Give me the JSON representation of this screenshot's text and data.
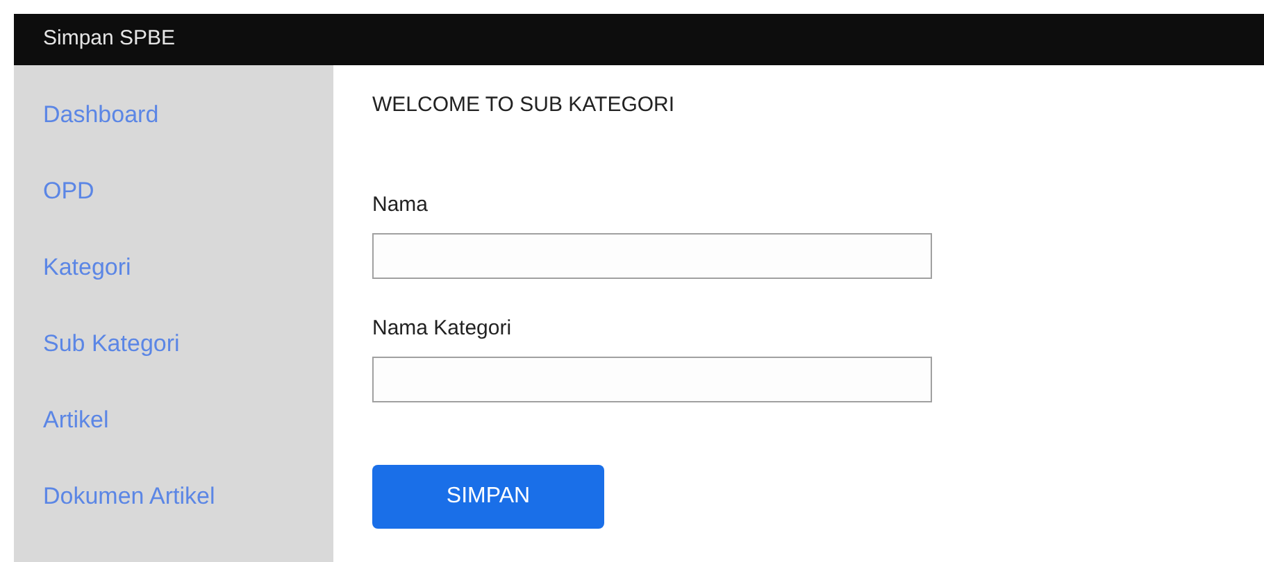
{
  "header": {
    "title": "Simpan SPBE"
  },
  "sidebar": {
    "items": [
      "Dashboard",
      "OPD",
      "Kategori",
      "Sub Kategori",
      "Artikel",
      "Dokumen Artikel"
    ]
  },
  "main": {
    "heading": "WELCOME TO SUB KATEGORI",
    "fields": [
      {
        "label": "Nama"
      },
      {
        "label": "Nama Kategori"
      }
    ],
    "submit": "SIMPAN"
  }
}
